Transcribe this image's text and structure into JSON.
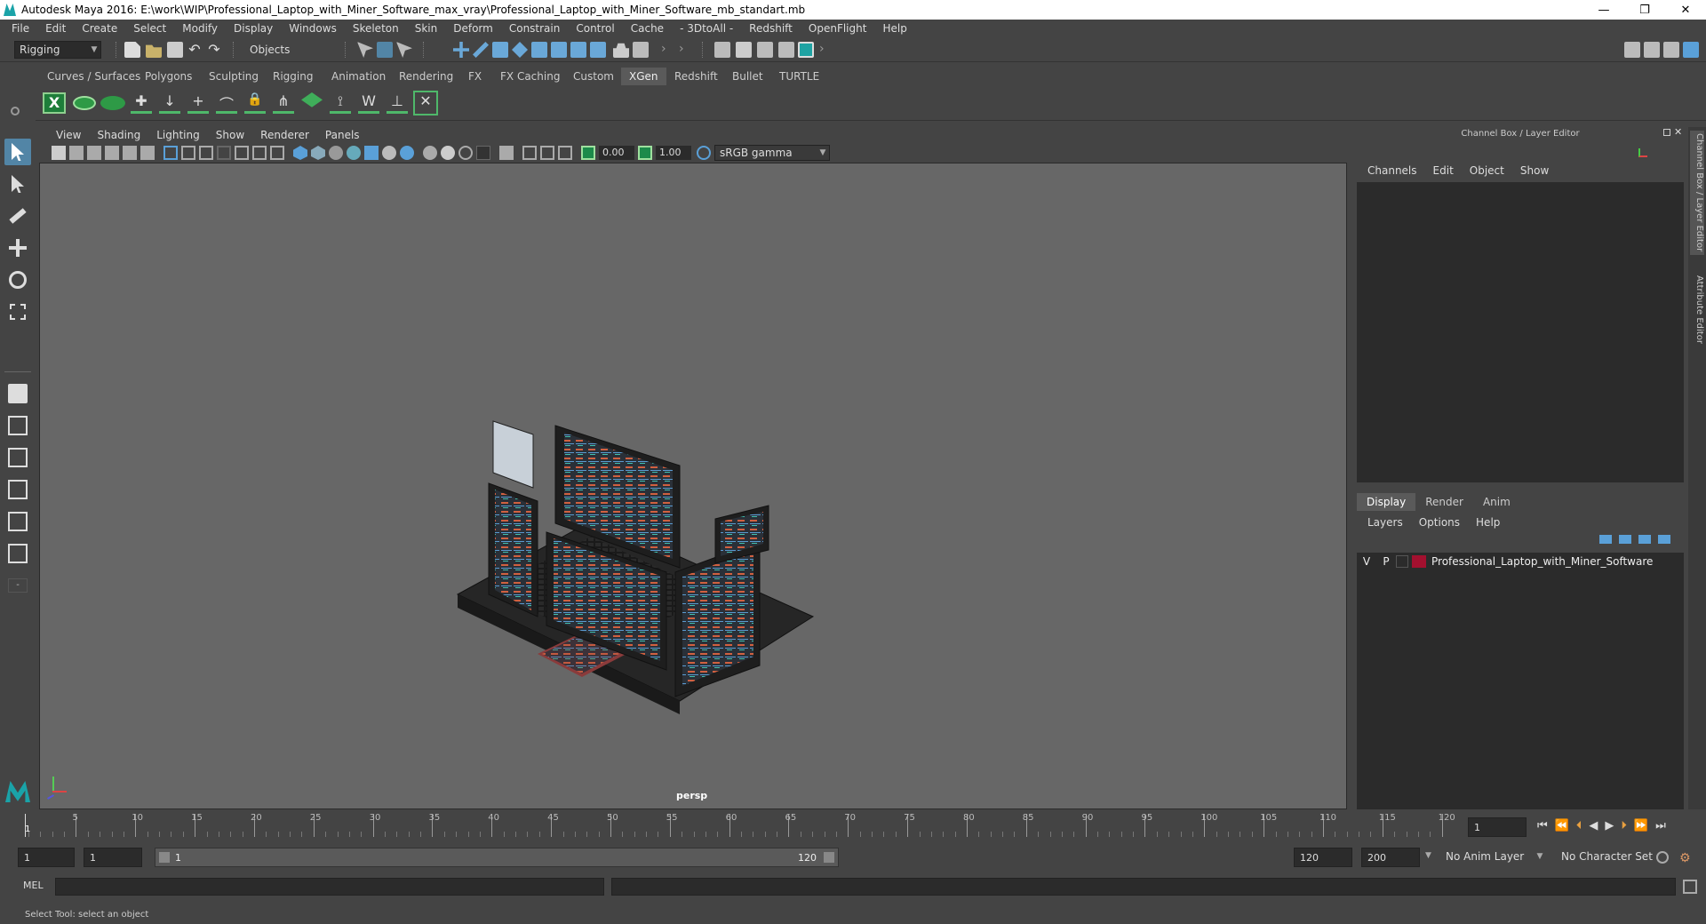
{
  "window": {
    "title": "Autodesk Maya 2016: E:\\work\\WIP\\Professional_Laptop_with_Miner_Software_max_vray\\Professional_Laptop_with_Miner_Software_mb_standart.mb",
    "min": "—",
    "max": "❐",
    "close": "✕"
  },
  "menu": [
    "File",
    "Edit",
    "Create",
    "Select",
    "Modify",
    "Display",
    "Windows",
    "Skeleton",
    "Skin",
    "Deform",
    "Constrain",
    "Control",
    "Cache",
    "- 3DtoAll -",
    "Redshift",
    "OpenFlight",
    "Help"
  ],
  "status": {
    "mode": "Rigging",
    "selection_mask": "Objects"
  },
  "shelf_tabs": [
    "Curves / Surfaces",
    "Polygons",
    "Sculpting",
    "Rigging",
    "Animation",
    "Rendering",
    "FX",
    "FX Caching",
    "Custom",
    "XGen",
    "Redshift",
    "Bullet",
    "TURTLE"
  ],
  "shelf_active": "XGen",
  "viewport": {
    "menu": [
      "View",
      "Shading",
      "Lighting",
      "Show",
      "Renderer",
      "Panels"
    ],
    "exposure": "0.00",
    "gamma": "1.00",
    "colorspace": "sRGB gamma",
    "camera": "persp"
  },
  "channel_box": {
    "title": "Channel Box / Layer Editor",
    "menu": [
      "Channels",
      "Edit",
      "Object",
      "Show"
    ]
  },
  "layer_editor": {
    "tabs": [
      "Display",
      "Render",
      "Anim"
    ],
    "active_tab": "Display",
    "menu": [
      "Layers",
      "Options",
      "Help"
    ],
    "layers": [
      {
        "v": "V",
        "p": "P",
        "name": "Professional_Laptop_with_Miner_Software",
        "color": "#a3102f"
      }
    ]
  },
  "side_tabs": [
    "Channel Box / Layer Editor",
    "Attribute Editor"
  ],
  "timeline": {
    "ticks": [
      "5",
      "10",
      "15",
      "20",
      "25",
      "30",
      "35",
      "40",
      "45",
      "50",
      "55",
      "60",
      "65",
      "70",
      "75",
      "80",
      "85",
      "90",
      "95",
      "100",
      "105",
      "110",
      "115",
      "120"
    ],
    "current_frame": "1",
    "start_marker": "1"
  },
  "range": {
    "start": "1",
    "playback_start": "1",
    "slider_start": "1",
    "slider_end": "120",
    "playback_end": "120",
    "end": "200",
    "anim_layer": "No Anim Layer",
    "character_set": "No Character Set"
  },
  "command_line": {
    "label": "MEL"
  },
  "help_line": "Select Tool: select an object",
  "colors": {
    "accent": "#5285a6",
    "viewport_bg": "#676767",
    "panel": "#444444",
    "field": "#2b2b2b"
  }
}
